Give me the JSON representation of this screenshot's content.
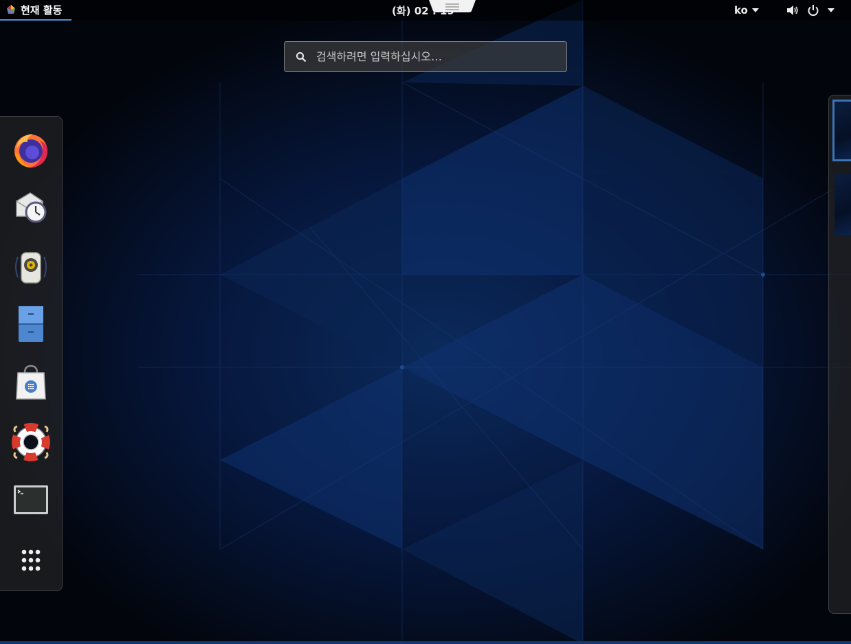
{
  "topbar": {
    "activities_label": "현재 활동",
    "clock": "(화) 02 : 19",
    "language": "ko"
  },
  "search": {
    "placeholder": "검색하려면 입력하십시오…"
  },
  "dash": {
    "items": [
      {
        "icon": "firefox-icon"
      },
      {
        "icon": "evolution-mail-clock-icon"
      },
      {
        "icon": "rhythmbox-speaker-icon"
      },
      {
        "icon": "files-cabinet-icon"
      },
      {
        "icon": "software-bag-icon"
      },
      {
        "icon": "help-lifebuoy-icon"
      },
      {
        "icon": "terminal-icon"
      },
      {
        "icon": "show-applications-icon"
      }
    ]
  },
  "workspaces": {
    "count": 2,
    "active": 1
  },
  "colors": {
    "accent": "#4a90d9",
    "panel": "#000000",
    "wallpaper": "#04070f"
  }
}
